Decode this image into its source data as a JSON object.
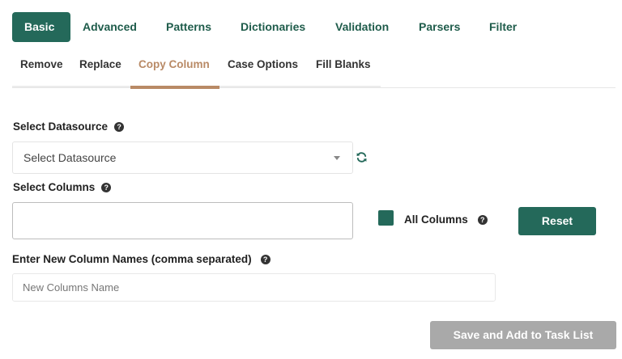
{
  "main_tabs": [
    "Basic",
    "Advanced",
    "Patterns",
    "Dictionaries",
    "Validation",
    "Parsers",
    "Filter"
  ],
  "sub_tabs": [
    "Remove",
    "Replace",
    "Copy Column",
    "Case Options",
    "Fill Blanks"
  ],
  "active_main_tab": "Basic",
  "active_sub_tab": "Copy Column",
  "datasource": {
    "label": "Select Datasource",
    "selected": "Select Datasource"
  },
  "columns": {
    "label": "Select Columns",
    "value": "",
    "all_columns_label": "All Columns",
    "all_columns_checked": true,
    "reset_label": "Reset"
  },
  "new_names": {
    "label": "Enter New Column Names (comma separated)",
    "placeholder": "New Columns Name",
    "value": ""
  },
  "save_label": "Save and Add to Task List",
  "colors": {
    "primary": "#24695a",
    "active_subtab": "#b98a66",
    "disabled_button": "#a9a9a9"
  },
  "icons": {
    "help": "question-circle-icon",
    "refresh": "refresh-icon",
    "caret": "caret-down-icon"
  }
}
